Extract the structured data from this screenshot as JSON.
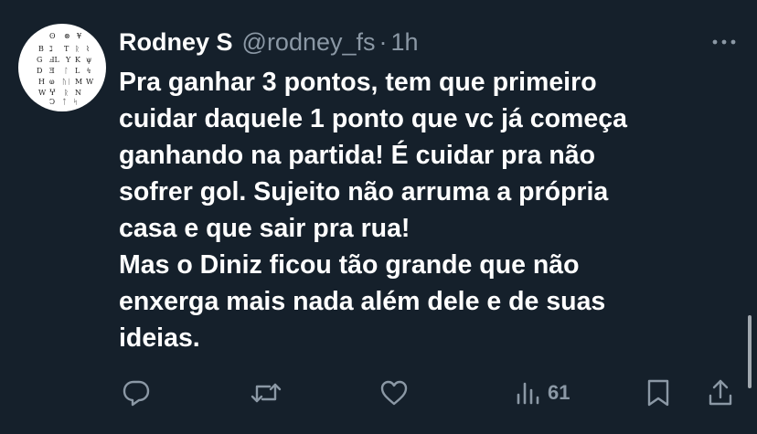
{
  "tweet": {
    "author_name": "Rodney S",
    "handle": "@rodney_fs",
    "separator": "·",
    "time": "1h",
    "body_lines": [
      "Pra ganhar 3 pontos, tem que primeiro",
      "cuidar daquele 1 ponto que vc já começa",
      "ganhando na partida! É cuidar pra não",
      "sofrer gol. Sujeito não arruma a própria",
      "casa e que sair pra rua!",
      "Mas o Diniz ficou tão grande que não",
      "enxerga mais nada além dele e de suas",
      "ideias."
    ],
    "views": "61"
  },
  "colors": {
    "background": "#15202b",
    "text": "#ffffff",
    "muted": "#8b98a5",
    "scrollbar": "#a0a7ae"
  },
  "icons": {
    "avatar": "alphabet-symbols-avatar",
    "more": "more-dots-icon",
    "reply": "reply-bubble-icon",
    "retweet": "retweet-icon",
    "like": "heart-icon",
    "views": "bar-chart-icon",
    "bookmark": "bookmark-icon",
    "share": "share-icon"
  }
}
